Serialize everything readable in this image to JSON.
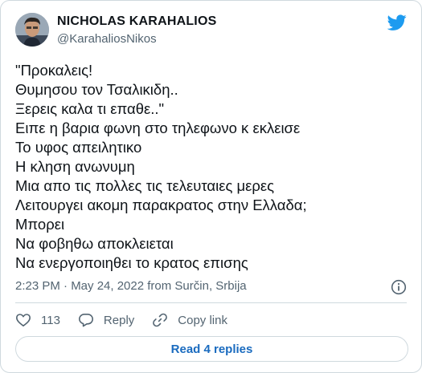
{
  "author": {
    "name": "NICHOLAS KARAHALIOS",
    "handle": "@KarahaliosNikos"
  },
  "tweet": {
    "lines": [
      "\"Προκαλεις!",
      "Θυμησου τον Τσαλικιδη..",
      "Ξερεις καλα τι επαθε..\"",
      "Ειπε η βαρια φωνη στο τηλεφωνο κ εκλεισε",
      "Το υφος απειλητικο",
      "Η κληση ανωνυμη",
      "Μια απο τις πολλες τις τελευταιες μερες",
      "Λειτουργει ακομη παρακρατος στην Ελλαδα;",
      "Μπορει",
      "Να φοβηθω αποκλειεται",
      "Να ενεργοποιηθει το κρατος επισης"
    ],
    "timestamp": "2:23 PM · May 24, 2022 from Surčin, Srbija"
  },
  "actions": {
    "likes_count": "113",
    "reply_label": "Reply",
    "copy_link_label": "Copy link"
  },
  "footer": {
    "read_replies_label": "Read 4 replies"
  },
  "icons": {
    "brand": "twitter-bird-icon",
    "info": "info-icon",
    "like": "heart-icon",
    "reply": "speech-bubble-icon",
    "copy_link": "link-icon"
  },
  "colors": {
    "brand_blue": "#1d9bf0",
    "link_blue": "#1a6bbf",
    "secondary_text": "#536471",
    "border": "#cfd9de"
  }
}
